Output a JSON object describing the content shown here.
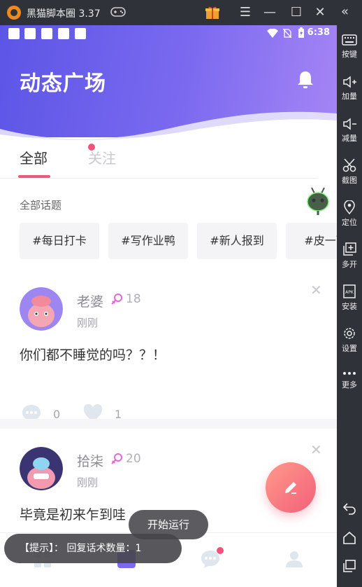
{
  "emulator": {
    "title": "黑猫脚本圈 3.37",
    "sidebar": [
      {
        "label": "按键",
        "icon": "keyboard-icon"
      },
      {
        "label": "加量",
        "icon": "volume-up-icon"
      },
      {
        "label": "减量",
        "icon": "volume-down-icon"
      },
      {
        "label": "截图",
        "icon": "scissors-icon"
      },
      {
        "label": "定位",
        "icon": "location-icon"
      },
      {
        "label": "多开",
        "icon": "multi-window-icon"
      },
      {
        "label": "安装",
        "icon": "apk-install-icon"
      },
      {
        "label": "设置",
        "icon": "settings-gear-icon"
      },
      {
        "label": "更多",
        "icon": "more-dots-icon"
      }
    ]
  },
  "statusbar": {
    "time": "6:38"
  },
  "header": {
    "title": "动态广场"
  },
  "tabs": [
    {
      "label": "全部",
      "active": true
    },
    {
      "label": "关注",
      "active": false,
      "has_dot": true
    }
  ],
  "topics": {
    "heading": "全部话题",
    "items": [
      "#每日打卡",
      "#写作业鸭",
      "#新人报到",
      "#皮一下"
    ]
  },
  "posts": [
    {
      "user": "老婆",
      "level": "18",
      "time": "刚刚",
      "content": "你们都不睡觉的吗？？！",
      "comments": "0",
      "likes": "1"
    },
    {
      "user": "拾柒",
      "level": "20",
      "time": "刚刚",
      "content": "毕竟是初来乍到哇"
    }
  ],
  "toasts": {
    "run": "开始运行",
    "tip": "【提示】： 回复话术数量：1"
  },
  "colors": {
    "header_start": "#5c55e6",
    "header_end": "#a585f5",
    "accent": "#f0547a",
    "fab_start": "#ff9a8a",
    "fab_end": "#f2607a"
  }
}
